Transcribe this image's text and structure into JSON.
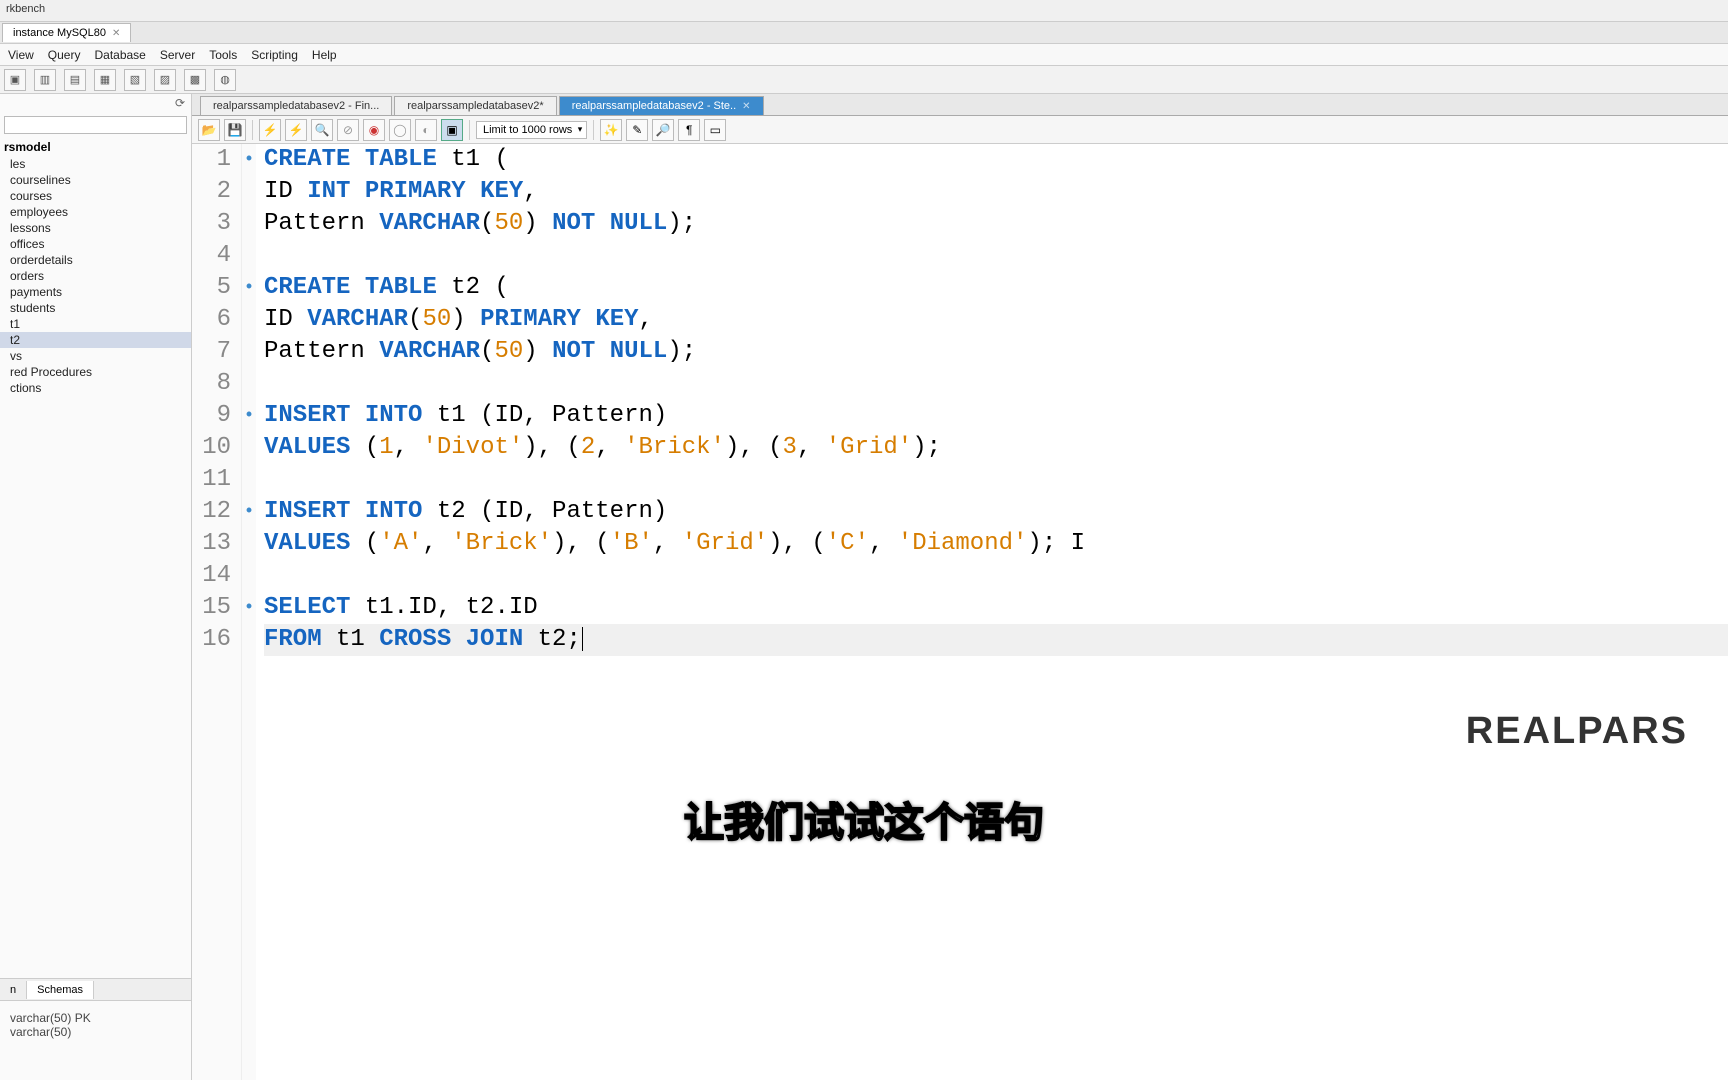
{
  "app": {
    "title": "rkbench"
  },
  "connection_tab": {
    "label": "instance MySQL80"
  },
  "menu": [
    "View",
    "Query",
    "Database",
    "Server",
    "Tools",
    "Scripting",
    "Help"
  ],
  "sidebar": {
    "schema_root": "rsmodel",
    "items": [
      "les",
      "courselines",
      "courses",
      "employees",
      "lessons",
      "offices",
      "orderdetails",
      "orders",
      "payments",
      "students",
      "t1",
      "t2",
      "vs",
      "red Procedures",
      "ctions"
    ],
    "selected_index": 11,
    "bottom_tabs": {
      "left": "n",
      "right": "Schemas"
    },
    "info_lines": [
      "varchar(50) PK",
      "varchar(50)"
    ]
  },
  "file_tabs": [
    {
      "label": "realparssampledatabasev2 - Fin...",
      "active": false
    },
    {
      "label": "realparssampledatabasev2*",
      "active": false
    },
    {
      "label": "realparssampledatabasev2 - Ste..",
      "active": true
    }
  ],
  "editor_toolbar": {
    "limit_label": "Limit to 1000 rows"
  },
  "code_lines": [
    {
      "n": 1,
      "m": true,
      "h": "<span class='kw'>CREATE</span> <span class='kw'>TABLE</span> t1 ("
    },
    {
      "n": 2,
      "m": false,
      "h": "ID <span class='ty'>INT</span> <span class='kw'>PRIMARY</span> <span class='kw'>KEY</span>,"
    },
    {
      "n": 3,
      "m": false,
      "h": "Pattern <span class='ty'>VARCHAR</span>(<span class='num'>50</span>) <span class='kw'>NOT</span> <span class='kw'>NULL</span>);"
    },
    {
      "n": 4,
      "m": false,
      "h": ""
    },
    {
      "n": 5,
      "m": true,
      "h": "<span class='kw'>CREATE</span> <span class='kw'>TABLE</span> t2 ("
    },
    {
      "n": 6,
      "m": false,
      "h": "ID <span class='ty'>VARCHAR</span>(<span class='num'>50</span>) <span class='kw'>PRIMARY</span> <span class='kw'>KEY</span>,"
    },
    {
      "n": 7,
      "m": false,
      "h": "Pattern <span class='ty'>VARCHAR</span>(<span class='num'>50</span>) <span class='kw'>NOT</span> <span class='kw'>NULL</span>);"
    },
    {
      "n": 8,
      "m": false,
      "h": ""
    },
    {
      "n": 9,
      "m": true,
      "h": "<span class='kw'>INSERT</span> <span class='kw'>INTO</span> t1 (ID, Pattern)"
    },
    {
      "n": 10,
      "m": false,
      "h": "<span class='kw'>VALUES</span> (<span class='num'>1</span>, <span class='str'>'Divot'</span>), (<span class='num'>2</span>, <span class='str'>'Brick'</span>), (<span class='num'>3</span>, <span class='str'>'Grid'</span>);"
    },
    {
      "n": 11,
      "m": false,
      "h": ""
    },
    {
      "n": 12,
      "m": true,
      "h": "<span class='kw'>INSERT</span> <span class='kw'>INTO</span> t2 (ID, Pattern)"
    },
    {
      "n": 13,
      "m": false,
      "h": "<span class='kw'>VALUES</span> (<span class='str'>'A'</span>, <span class='str'>'Brick'</span>), (<span class='str'>'B'</span>, <span class='str'>'Grid'</span>), (<span class='str'>'C'</span>, <span class='str'>'Diamond'</span>); <span style='color:#000;font-weight:normal'>I</span>"
    },
    {
      "n": 14,
      "m": false,
      "h": ""
    },
    {
      "n": 15,
      "m": true,
      "h": "<span class='kw'>SELECT</span> t1.ID, t2.ID"
    },
    {
      "n": 16,
      "m": false,
      "cursor": true,
      "h": "<span class='kw'>FROM</span> t1 <span class='kw'>CROSS</span> <span class='kw'>JOIN</span> t2;<span class='text-cursor'></span>"
    }
  ],
  "logo_text": "REALPARS",
  "subtitle_text": "让我们试试这个语句"
}
